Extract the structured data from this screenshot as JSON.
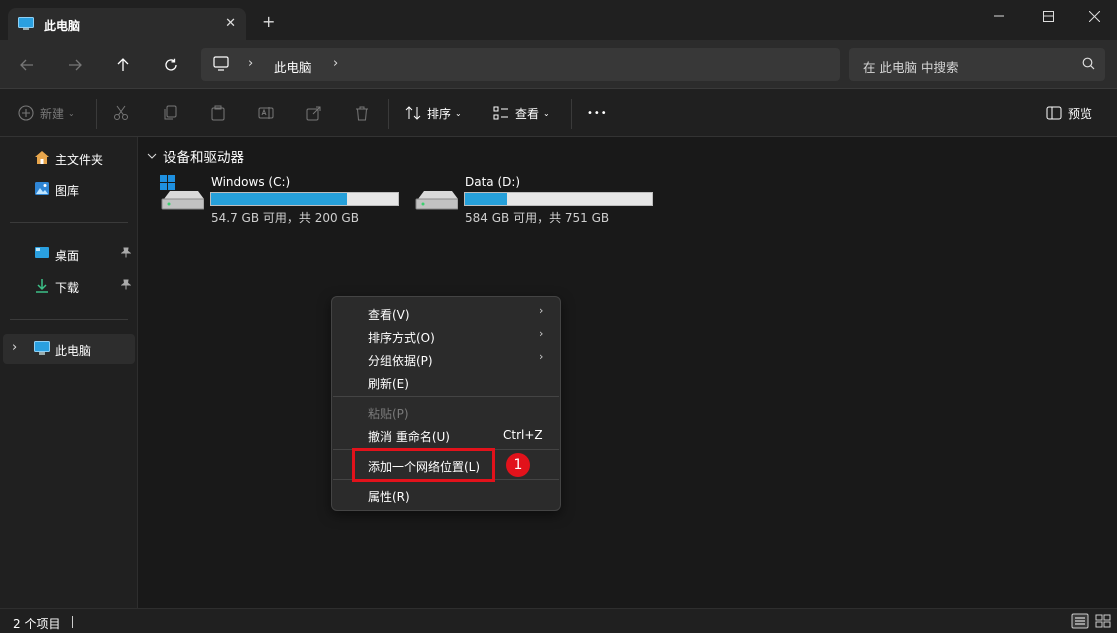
{
  "tab": {
    "title": "此电脑",
    "close": "✕",
    "new_tab": "+"
  },
  "window": {
    "minimize": "–",
    "maximize": "☐",
    "close": "✕"
  },
  "address": {
    "crumb": "此电脑"
  },
  "search": {
    "placeholder": "在 此电脑 中搜索"
  },
  "toolbar": {
    "new_label": "新建",
    "sort_label": "排序",
    "view_label": "查看",
    "more_label": "•••",
    "preview_label": "预览"
  },
  "sidebar": {
    "items": [
      {
        "label": "主文件夹"
      },
      {
        "label": "图库"
      },
      {
        "label": "桌面"
      },
      {
        "label": "下载"
      },
      {
        "label": "此电脑"
      }
    ]
  },
  "main": {
    "group_title": "设备和驱动器",
    "drives": [
      {
        "name": "Windows (C:)",
        "free": "54.7 GB 可用，共 200 GB",
        "used_fraction": 0.7265
      },
      {
        "name": "Data (D:)",
        "free": "584 GB 可用，共 751 GB",
        "used_fraction": 0.2224
      }
    ]
  },
  "context_menu": {
    "items": [
      {
        "label": "查看(V)"
      },
      {
        "label": "排序方式(O)"
      },
      {
        "label": "分组依据(P)"
      },
      {
        "label": "刷新(E)"
      },
      {
        "label": "粘贴(P)"
      },
      {
        "label": "撤消 重命名(U)",
        "shortcut": "Ctrl+Z"
      },
      {
        "label": "添加一个网络位置(L)"
      },
      {
        "label": "属性(R)"
      }
    ]
  },
  "annotation": {
    "badge": "1"
  },
  "status": {
    "text": "2 个项目"
  },
  "colors": {
    "accent": "#26a0da",
    "highlight": "#e2121b"
  }
}
